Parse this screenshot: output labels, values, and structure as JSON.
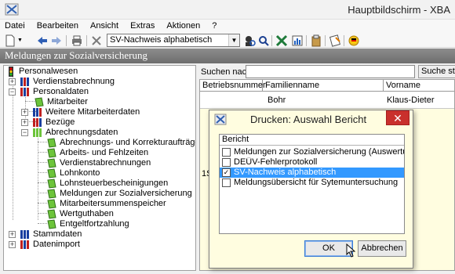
{
  "window": {
    "title": "Hauptbildschirm - XBA"
  },
  "menu": [
    "Datei",
    "Bearbeiten",
    "Ansicht",
    "Extras",
    "Aktionen",
    "?"
  ],
  "toolbar": {
    "report_select_value": "SV-Nachweis alphabetisch"
  },
  "section": {
    "title": "Meldungen zur Sozialversicherung"
  },
  "tree": [
    {
      "label": "Personalwesen"
    },
    {
      "label": "Verdienstabrechnung"
    },
    {
      "label": "Personaldaten"
    },
    {
      "label": "Mitarbeiter"
    },
    {
      "label": "Weitere Mitarbeiterdaten"
    },
    {
      "label": "Bezüge"
    },
    {
      "label": "Abrechnungsdaten"
    },
    {
      "label": "Abrechnungs- und Korrekturaufträge"
    },
    {
      "label": "Arbeits- und Fehlzeiten"
    },
    {
      "label": "Verdienstabrechnungen"
    },
    {
      "label": "Lohnkonto"
    },
    {
      "label": "Lohnsteuerbescheinigungen"
    },
    {
      "label": "Meldungen zur Sozialversicherung"
    },
    {
      "label": "Mitarbeitersummenspeicher"
    },
    {
      "label": "Wertguthaben"
    },
    {
      "label": "Entgeltfortzahlung"
    },
    {
      "label": "Stammdaten"
    },
    {
      "label": "Datenimport"
    }
  ],
  "search": {
    "label": "Suchen nach:",
    "button": "Suche starten",
    "value": ""
  },
  "grid": {
    "columns": [
      "Betriebsnummer",
      "Familienname",
      "Vorname"
    ],
    "row": {
      "betriebsnummer": "",
      "familienname": "Bohr",
      "vorname": "Klaus-Dieter"
    },
    "fragment": "1S"
  },
  "dialog": {
    "title": "Drucken: Auswahl Bericht",
    "list_header": "Bericht",
    "items": [
      {
        "label": "Meldungen zur Sozialversicherung (Auswertung Berufsg...",
        "checked": false,
        "selected": false
      },
      {
        "label": "DEÜV-Fehlerprotokoll",
        "checked": false,
        "selected": false
      },
      {
        "label": "SV-Nachweis alphabetisch",
        "checked": true,
        "selected": true
      },
      {
        "label": "Meldungsübersicht für Sytemuntersuchung",
        "checked": false,
        "selected": false
      }
    ],
    "ok_label": "OK",
    "cancel_label": "Abbrechen"
  },
  "colors": {
    "selection": "#3399ff",
    "background_yellow": "#fffde0",
    "close_red": "#c9302c"
  }
}
